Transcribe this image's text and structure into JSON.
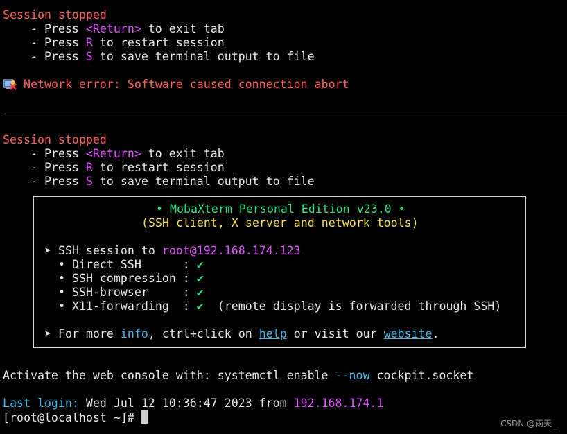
{
  "session1": {
    "stopped": "Session stopped",
    "press": "    - Press ",
    "return_key": "<Return>",
    "return_text": " to exit tab",
    "r_key": "R",
    "r_text": " to restart session",
    "s_key": "S",
    "s_text": " to save terminal output to file"
  },
  "network_error": "Network error: Software caused connection abort",
  "session2": {
    "stopped": "Session stopped",
    "press": "    - Press ",
    "return_key": "<Return>",
    "return_text": " to exit tab",
    "r_key": "R",
    "r_text": " to restart session",
    "s_key": "S",
    "s_text": " to save terminal output to file"
  },
  "banner": {
    "title": "• MobaXterm Personal Edition v23.0 •",
    "subtitle": "(SSH client, X server and network tools)",
    "ssh_prefix": "➤ SSH session to ",
    "ssh_target": "root@192.168.174.123",
    "features": [
      {
        "label": "  • Direct SSH      : ",
        "check": "✔",
        "note": ""
      },
      {
        "label": "  • SSH compression : ",
        "check": "✔",
        "note": ""
      },
      {
        "label": "  • SSH-browser     : ",
        "check": "✔",
        "note": ""
      },
      {
        "label": "  • X11-forwarding  : ",
        "check": "✔",
        "note": "  (remote display is forwarded through SSH)"
      }
    ],
    "more_prefix": "➤ For more ",
    "info_link": "info",
    "more_mid": ", ctrl+click on ",
    "help_link": "help",
    "more_mid2": " or visit our ",
    "website_link": "website",
    "more_end": "."
  },
  "activate": {
    "text": "Activate the web console with: systemctl enable ",
    "flag": "--now",
    "socket": " cockpit.socket"
  },
  "last_login": {
    "label": "Last login:",
    "date": " Wed Jul 12 10:36:47 2023 from ",
    "ip": "192.168.174.1"
  },
  "prompt": "[root@localhost ~]# ",
  "watermark": "CSDN @雨天_",
  "colors": {
    "background": "#000000",
    "error_red": "#ff5c5c",
    "key_magenta": "#e050ff",
    "link_cyan": "#3fb8e6",
    "check_green": "#2ee07a",
    "title_green": "#2ee07a",
    "subtitle_yellow": "#f4e24a"
  }
}
